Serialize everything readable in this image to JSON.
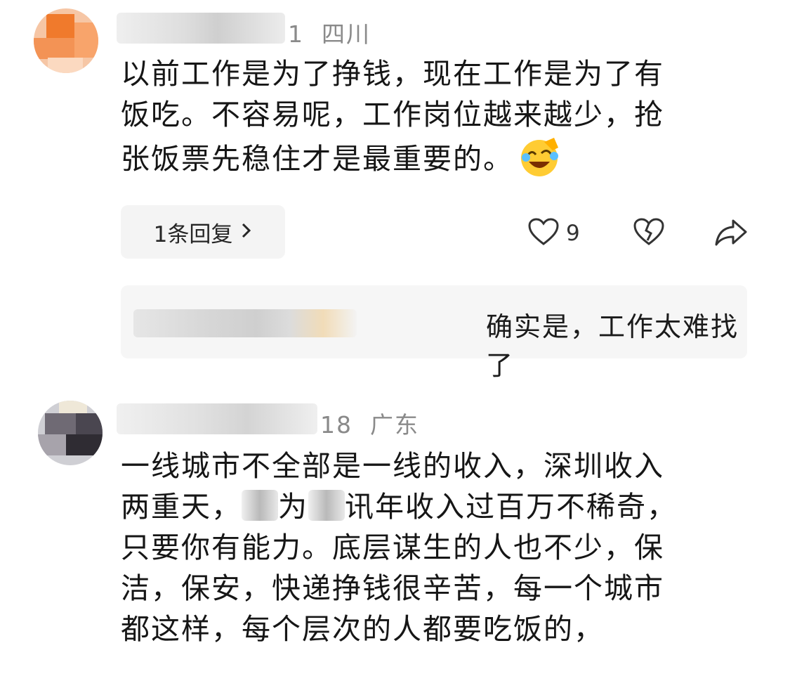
{
  "comments": [
    {
      "meta_date": "1",
      "meta_region": "四川",
      "lines": [
        "以前工作是为了挣钱，现在工作是为了有",
        "饭吃。不容易呢，工作岗位越来越少，抢",
        "张饭票先稳住才是最重要的。"
      ],
      "emoji": "laughing-crying-emoji",
      "reply_button": "1条回复",
      "like_count": "9",
      "reply_preview_text": "确实是，工作太难找了"
    },
    {
      "meta_date": "18",
      "meta_region": "广东",
      "line1": "一线城市不全部是一线的收入，深圳收入",
      "line2_a": "两重天，",
      "line2_b": "为",
      "line2_c": "讯年收入过百万不稀奇，",
      "line3": "只要你有能力。底层谋生的人也不少，保",
      "line4": "洁，保安，快递挣钱很辛苦，每一个城市",
      "line5": "都这样，每个层次的人都要吃饭的，"
    }
  ],
  "colors": {
    "meta_gray": "#8a8a8a",
    "text": "#161616",
    "pill_bg": "#f4f4f4",
    "avatar1_orange": "#f07a2c"
  },
  "icons": [
    "heart-icon",
    "broken-heart-icon",
    "share-icon",
    "chevron-right-icon"
  ]
}
